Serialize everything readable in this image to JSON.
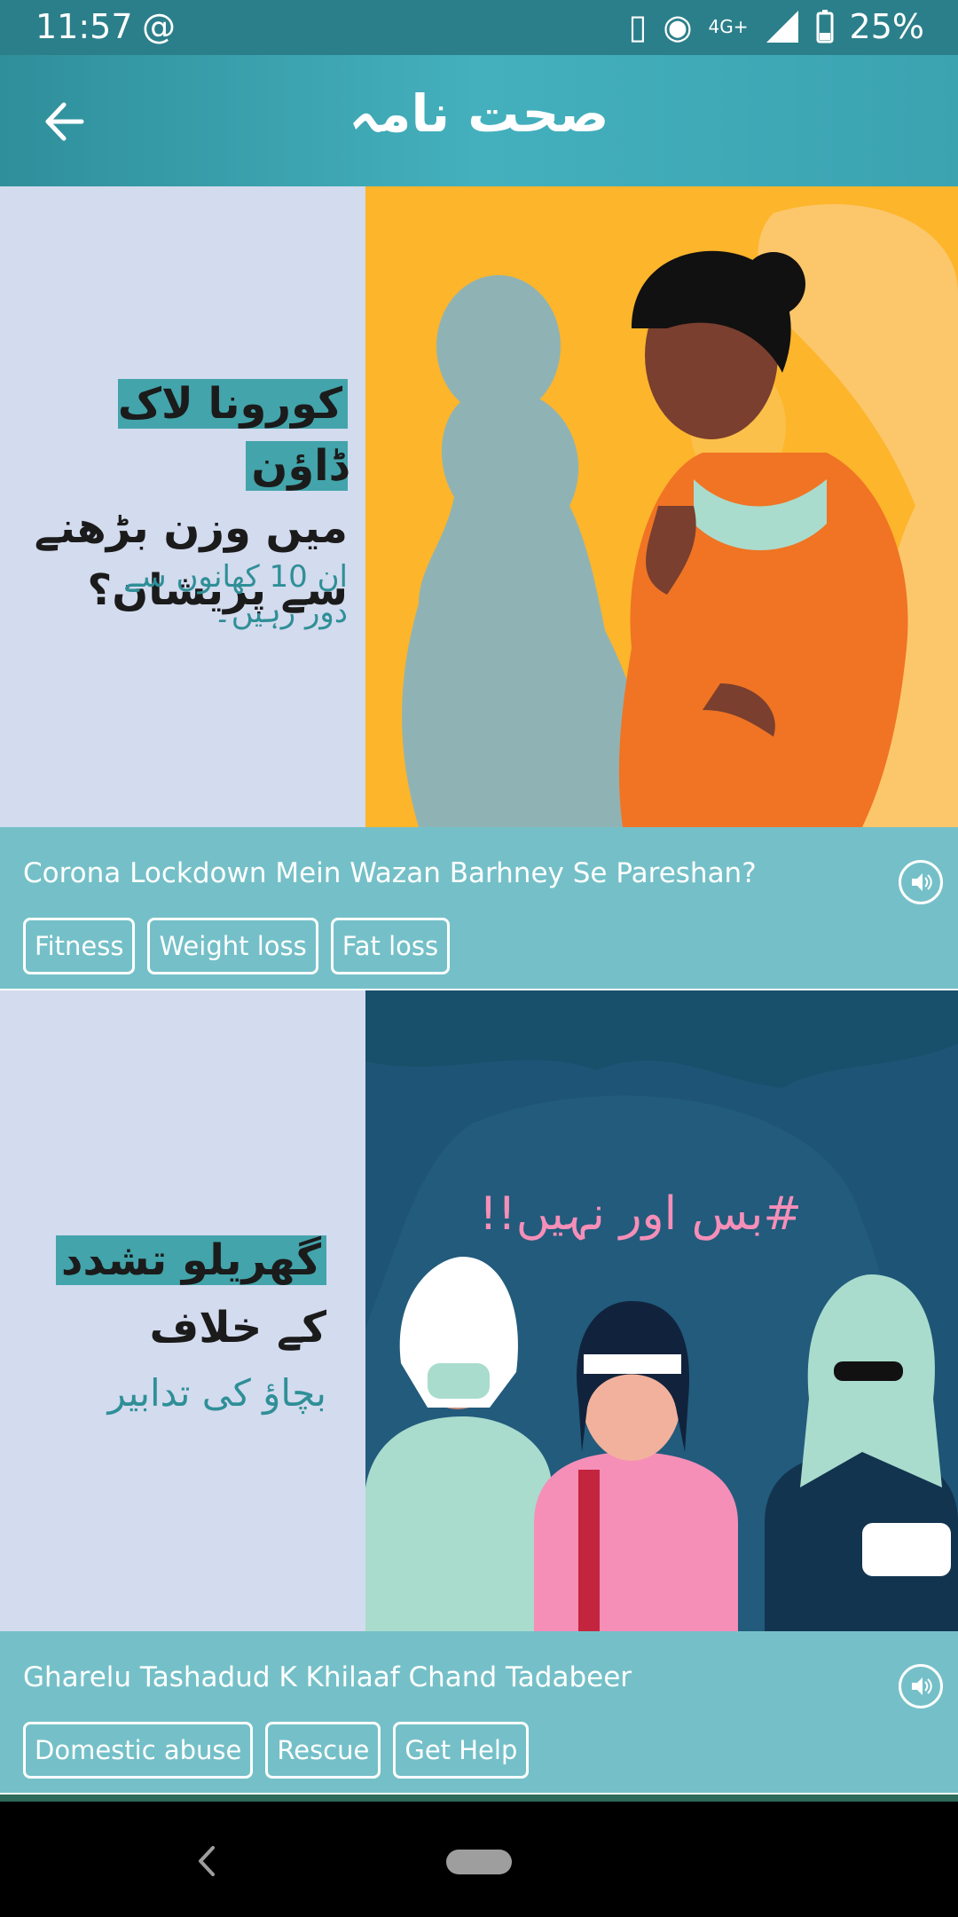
{
  "status_bar": {
    "time": "11:57",
    "network": "4G+",
    "battery": "25%"
  },
  "app_bar": {
    "title": "صحت نامہ"
  },
  "cards": [
    {
      "image_text": {
        "headline_highlight": "کورونا لاک ڈاؤن",
        "headline_line2": "میں وزن بڑھنے",
        "headline_line3": "سے پریشان؟",
        "sub_line1": "ان 10 کھانوں سے",
        "sub_line2": "دور رہیں۔"
      },
      "title": "Corona Lockdown Mein Wazan Barhney Se Pareshan?",
      "tags": [
        "Fitness",
        "Weight loss",
        "Fat loss"
      ]
    },
    {
      "image_text": {
        "hashtag": "#بس اور نہیں!!",
        "headline_highlight": "گھریلو تشدد",
        "headline_line2": "کے خلاف",
        "sub_line1": "بچاؤ کی تدابیر"
      },
      "title": "Gharelu Tashadud K Khilaaf Chand Tadabeer",
      "tags": [
        "Domestic abuse",
        "Rescue",
        "Get Help"
      ]
    }
  ],
  "colors": {
    "status_bar": "#2b7f8a",
    "app_bar": "#3ba3b0",
    "card_info": "#75c0c8",
    "highlight": "#43a4ab",
    "card1_bg": "#fdb52b",
    "card2_bg": "#1e5576"
  }
}
